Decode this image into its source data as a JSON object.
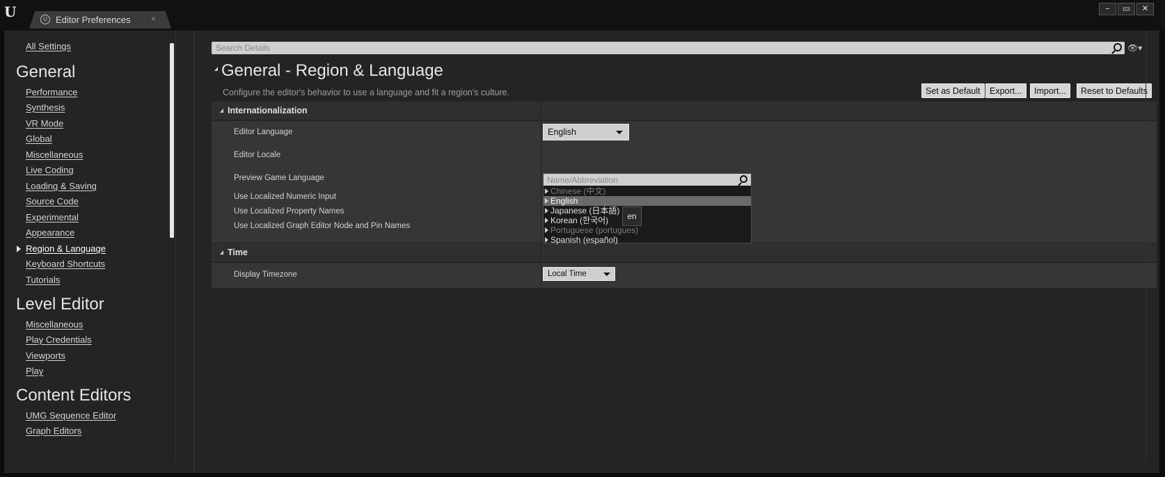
{
  "window": {
    "tab_title": "Editor Preferences",
    "tab_close": "×",
    "controls": {
      "minimize": "–",
      "maximize": "▭",
      "close": "✕"
    }
  },
  "nav": {
    "all_settings": "All Settings",
    "sections": [
      {
        "heading": "General",
        "items": [
          "Performance",
          "Synthesis",
          "VR Mode",
          "Global",
          "Miscellaneous",
          "Live Coding",
          "Loading & Saving",
          "Source Code",
          "Experimental",
          "Appearance",
          "Region & Language",
          "Keyboard Shortcuts",
          "Tutorials"
        ]
      },
      {
        "heading": "Level Editor",
        "items": [
          "Miscellaneous",
          "Play Credentials",
          "Viewports",
          "Play"
        ]
      },
      {
        "heading": "Content Editors",
        "items": [
          "UMG Sequence Editor",
          "Graph Editors"
        ]
      }
    ],
    "active_item": "Region & Language"
  },
  "search": {
    "placeholder": "Search Details"
  },
  "header": {
    "title": "General - Region & Language",
    "description": "Configure the editor's behavior to use a language and fit a region's culture."
  },
  "actions": {
    "set_default": "Set as Default",
    "export": "Export...",
    "import": "Import...",
    "reset": "Reset to Defaults"
  },
  "internationalization": {
    "label": "Internationalization",
    "editor_language_label": "Editor Language",
    "editor_language_value": "English",
    "editor_locale_label": "Editor Locale",
    "preview_game_language_label": "Preview Game Language",
    "localized_numeric_label": "Use Localized Numeric Input",
    "localized_property_label": "Use Localized Property Names",
    "localized_graph_label": "Use Localized Graph Editor Node and Pin Names",
    "localized_graph_checked": true
  },
  "time": {
    "label": "Time",
    "display_timezone_label": "Display Timezone",
    "display_timezone_value": "Local Time"
  },
  "language_popup": {
    "search_placeholder": "Name/Abbreviation",
    "items": [
      {
        "label": "Chinese (中文)",
        "dim": true
      },
      {
        "label": "English",
        "selected": true
      },
      {
        "label": "Japanese (日本語)"
      },
      {
        "label": "Korean (한국어)"
      },
      {
        "label": "Portuguese (portugues)",
        "dim": true
      },
      {
        "label": "Spanish (español)"
      }
    ],
    "tooltip": "en"
  },
  "colors": {
    "background": "#242424",
    "button": "#d6d6d6",
    "selected_row": "#6a6a6a"
  }
}
